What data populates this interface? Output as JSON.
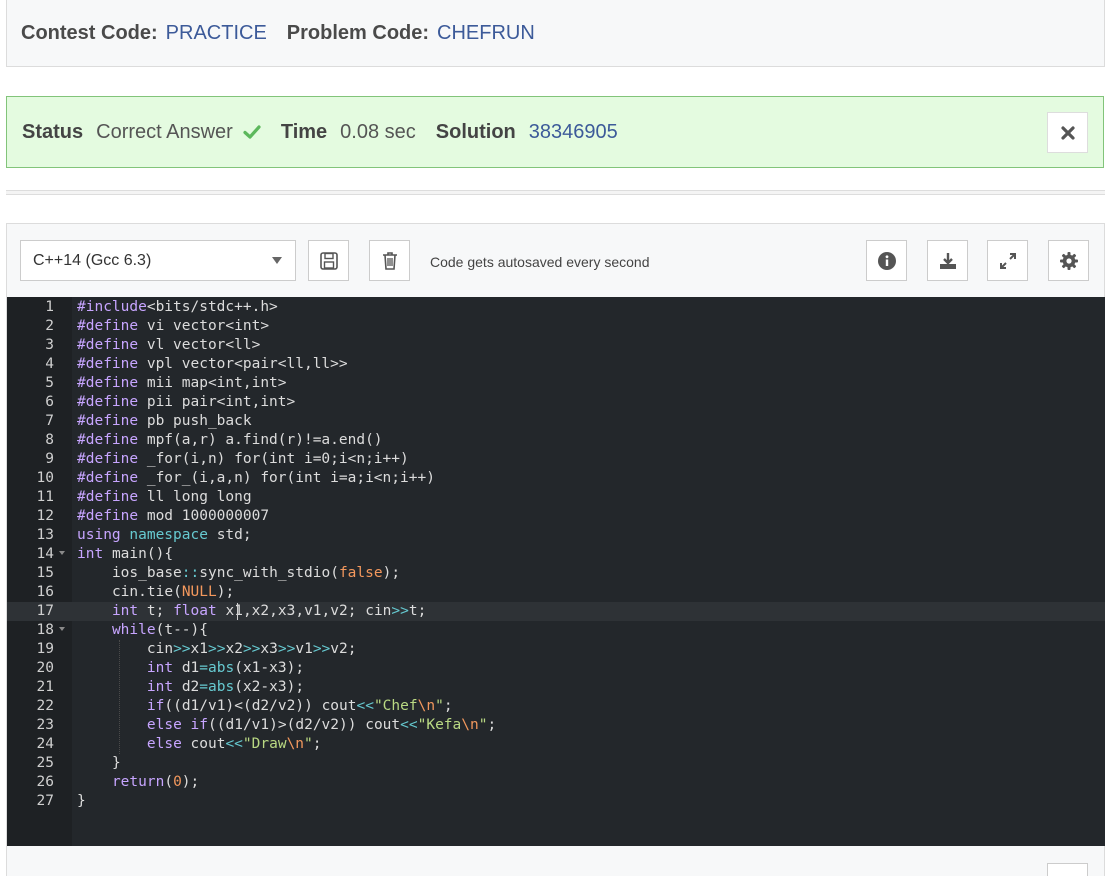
{
  "header": {
    "contest_label": "Contest Code:",
    "contest_value": "PRACTICE",
    "problem_label": "Problem Code:",
    "problem_value": "CHEFRUN"
  },
  "status": {
    "status_label": "Status",
    "status_value": "Correct Answer",
    "time_label": "Time",
    "time_value": "0.08 sec",
    "solution_label": "Solution",
    "solution_value": "38346905",
    "close_icon": "close-icon",
    "success_color": "#5cb85c"
  },
  "toolbar": {
    "language": "C++14 (Gcc 6.3)",
    "autosave_text": "Code gets autosaved every second",
    "icons": [
      "save-icon",
      "trash-icon",
      "info-icon",
      "download-icon",
      "expand-icon",
      "gear-icon"
    ]
  },
  "code": {
    "lines": [
      "#include<bits/stdc++.h>",
      "#define vi vector<int>",
      "#define vl vector<ll>",
      "#define vpl vector<pair<ll,ll>>",
      "#define mii map<int,int>",
      "#define pii pair<int,int>",
      "#define pb push_back",
      "#define mpf(a,r) a.find(r)!=a.end()",
      "#define _for(i,n) for(int i=0;i<n;i++)",
      "#define _for_(i,a,n) for(int i=a;i<n;i++)",
      "#define ll long long",
      "#define mod 1000000007",
      "using namespace std;",
      "int main(){",
      "    ios_base::sync_with_stdio(false);",
      "    cin.tie(NULL);",
      "    int t; float x1,x2,x3,v1,v2; cin>>t;",
      "    while(t--){",
      "        cin>>x1>>x2>>x3>>v1>>v2;",
      "        int d1=abs(x1-x3);",
      "        int d2=abs(x2-x3);",
      "        if((d1/v1)<(d2/v2)) cout<<\"Chef\\n\";",
      "        else if((d1/v1)>(d2/v2)) cout<<\"Kefa\\n\";",
      "        else cout<<\"Draw\\n\";",
      "    }",
      "    return(0);",
      "}"
    ],
    "fold_lines": [
      14,
      18
    ],
    "active_line": 17
  }
}
